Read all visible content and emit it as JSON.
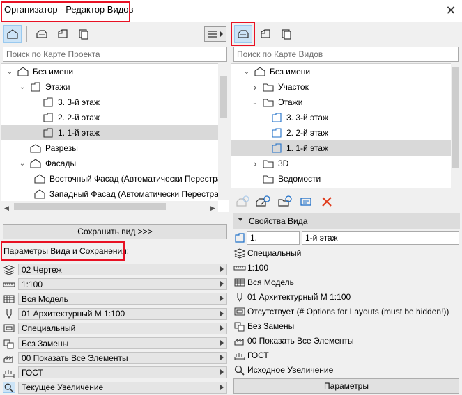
{
  "window": {
    "title": "Организатор - Редактор Видов",
    "close_glyph": "✕"
  },
  "left": {
    "search_placeholder": "Поиск по Карте Проекта",
    "tree": [
      {
        "label": "Без имени",
        "icon": "project-icon",
        "depth": 0,
        "expanded": true
      },
      {
        "label": "Этажи",
        "icon": "stories-icon",
        "depth": 1,
        "expanded": true
      },
      {
        "label": "3. 3-й этаж",
        "icon": "story-icon",
        "depth": 2
      },
      {
        "label": "2. 2-й этаж",
        "icon": "story-icon",
        "depth": 2
      },
      {
        "label": "1. 1-й этаж",
        "icon": "story-icon",
        "depth": 2,
        "selected": true
      },
      {
        "label": "Разрезы",
        "icon": "section-icon",
        "depth": 1
      },
      {
        "label": "Фасады",
        "icon": "elevation-icon",
        "depth": 1,
        "expanded": true
      },
      {
        "label": "Восточный Фасад (Автоматически Перестраив",
        "icon": "elevation-icon",
        "depth": 2
      },
      {
        "label": "Западный Фасад (Автоматически Перестраива",
        "icon": "elevation-icon",
        "depth": 2
      }
    ],
    "save_view_button": "Сохранить вид >>>",
    "params_header": "Параметры Вида и Сохранения:",
    "params": [
      {
        "icon": "layers-icon",
        "value": "02 Чертеж"
      },
      {
        "icon": "scale-icon",
        "value": "1:100"
      },
      {
        "icon": "structure-icon",
        "value": "Вся Модель"
      },
      {
        "icon": "pen-icon",
        "value": "01 Архитектурный М 1:100"
      },
      {
        "icon": "mvo-icon",
        "value": "Специальный"
      },
      {
        "icon": "override-icon",
        "value": "Без Замены"
      },
      {
        "icon": "renovation-icon",
        "value": "00 Показать Все Элементы"
      },
      {
        "icon": "dimension-icon",
        "value": "ГОСТ"
      },
      {
        "icon": "zoom-icon",
        "value": "Текущее Увеличение"
      }
    ]
  },
  "right": {
    "search_placeholder": "Поиск по Карте Видов",
    "tree": [
      {
        "label": "Без имени",
        "icon": "project-icon",
        "depth": 0,
        "expanded": true
      },
      {
        "label": "Участок",
        "icon": "folder-icon",
        "depth": 1,
        "expanded": false
      },
      {
        "label": "Этажи",
        "icon": "folder-icon",
        "depth": 1,
        "expanded": true
      },
      {
        "label": "3. 3-й этаж",
        "icon": "story-icon",
        "depth": 2
      },
      {
        "label": "2. 2-й этаж",
        "icon": "story-icon",
        "depth": 2
      },
      {
        "label": "1. 1-й этаж",
        "icon": "story-icon",
        "depth": 2,
        "selected": true
      },
      {
        "label": "3D",
        "icon": "folder-icon",
        "depth": 1,
        "expanded": false
      },
      {
        "label": "Ведомости",
        "icon": "folder-icon",
        "depth": 1
      }
    ],
    "props_header": "Свойства Вида",
    "id_value": "1.",
    "name_value": "1-й этаж",
    "props": [
      {
        "icon": "layers-icon",
        "value": "Специальный"
      },
      {
        "icon": "scale-icon",
        "value": "1:100"
      },
      {
        "icon": "structure-icon",
        "value": "Вся Модель"
      },
      {
        "icon": "pen-icon",
        "value": "01 Архитектурный М 1:100"
      },
      {
        "icon": "mvo-icon",
        "value": "Отсутствует (# Options for Layouts (must be hidden!))"
      },
      {
        "icon": "override-icon",
        "value": "Без Замены"
      },
      {
        "icon": "renovation-icon",
        "value": "00 Показать Все Элементы"
      },
      {
        "icon": "dimension-icon",
        "value": "ГОСТ"
      },
      {
        "icon": "zoom-icon",
        "value": "Исходное Увеличение"
      }
    ],
    "params_button": "Параметры"
  },
  "colors": {
    "highlight": "#e81123",
    "selected_row": "#d9d9d9",
    "icon_blue": "#1e6fc8"
  }
}
